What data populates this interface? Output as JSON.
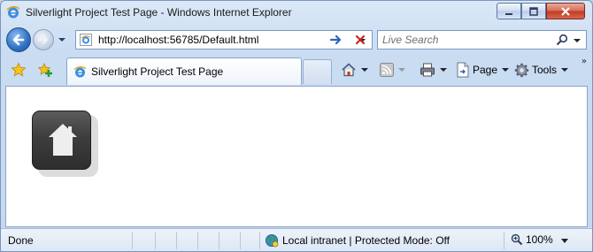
{
  "window": {
    "title": "Silverlight Project Test Page - Windows Internet Explorer",
    "icons": {
      "app": "ie-icon",
      "minimize": "minimize-icon",
      "maximize": "maximize-icon",
      "close": "close-icon"
    }
  },
  "address_bar": {
    "url": "http://localhost:56785/Default.html",
    "icons": {
      "back": "back-arrow-icon",
      "forward": "forward-arrow-icon",
      "go": "go-arrow-icon",
      "stop": "stop-x-icon",
      "favicon": "ie-page-icon"
    }
  },
  "search": {
    "placeholder": "Live Search",
    "icon": "search-magnifier-icon"
  },
  "tabs": [
    {
      "label": "Silverlight Project Test Page",
      "active": true
    }
  ],
  "command_bar": {
    "page_label": "Page",
    "tools_label": "Tools",
    "icons": [
      "favorites-star-icon",
      "add-favorites-icon",
      "home-icon",
      "rss-feeds-icon",
      "print-icon",
      "page-icon",
      "tools-gear-icon"
    ]
  },
  "content": {
    "tile_icon": "home-icon",
    "tile_color": "#3a3a3a"
  },
  "status_bar": {
    "status": "Done",
    "zone": "Local intranet | Protected Mode: Off",
    "zoom": "100%"
  },
  "colors": {
    "frame": "#c9dcf2",
    "close_button": "#c9432a",
    "back_button": "#2e6fc2"
  }
}
